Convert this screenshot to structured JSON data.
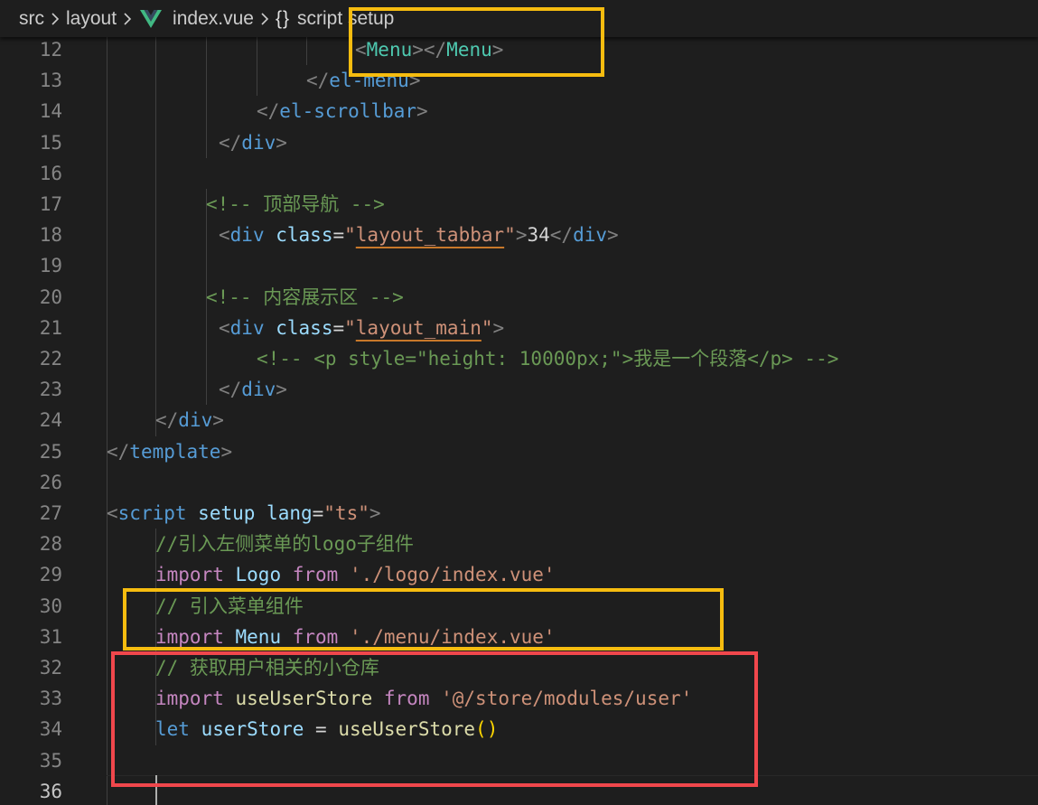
{
  "breadcrumb": {
    "items": [
      "src",
      "layout",
      "index.vue",
      "script setup"
    ],
    "braces_glyph": "{}",
    "vue_icon": "vue-logo-icon",
    "chevron_icon": "chevron-right-icon"
  },
  "colors": {
    "background": "#1e1e1e",
    "line_number": "#858585",
    "highlight_yellow": "#f6bc0f",
    "highlight_red": "#f0474c"
  },
  "editor": {
    "active_line": "36",
    "lines": [
      {
        "number": "12",
        "indent": 0,
        "tokens": [
          [
            "bracket",
            "<"
          ],
          [
            "comp",
            "Menu"
          ],
          [
            "bracket",
            "></"
          ],
          [
            "comp",
            "Menu"
          ],
          [
            "bracket",
            ">"
          ]
        ]
      },
      {
        "number": "13",
        "indent": 0,
        "tokens": [
          [
            "bracket",
            "</"
          ],
          [
            "tag",
            "el-menu"
          ],
          [
            "bracket",
            ">"
          ]
        ]
      },
      {
        "number": "14",
        "indent": 0,
        "tokens": [
          [
            "bracket",
            "</"
          ],
          [
            "tag",
            "el-scrollbar"
          ],
          [
            "bracket",
            ">"
          ]
        ]
      },
      {
        "number": "15",
        "indent": 0,
        "tokens": [
          [
            "bracket",
            "</"
          ],
          [
            "tag",
            "div"
          ],
          [
            "bracket",
            ">"
          ]
        ]
      },
      {
        "number": "16",
        "indent": 0,
        "tokens": []
      },
      {
        "number": "17",
        "indent": 0,
        "tokens": [
          [
            "comment",
            "<!-- 顶部导航 -->"
          ]
        ]
      },
      {
        "number": "18",
        "indent": 0,
        "tokens": [
          [
            "bracket",
            "<"
          ],
          [
            "tag",
            "div"
          ],
          [
            "plain",
            " "
          ],
          [
            "attr",
            "class"
          ],
          [
            "plain",
            "="
          ],
          [
            "str",
            "\""
          ],
          [
            "strcls",
            "layout_tabbar"
          ],
          [
            "str",
            "\""
          ],
          [
            "bracket",
            ">"
          ],
          [
            "plain",
            "34"
          ],
          [
            "bracket",
            "</"
          ],
          [
            "tag",
            "div"
          ],
          [
            "bracket",
            ">"
          ]
        ]
      },
      {
        "number": "19",
        "indent": 0,
        "tokens": []
      },
      {
        "number": "20",
        "indent": 0,
        "tokens": [
          [
            "comment",
            "<!-- 内容展示区 -->"
          ]
        ]
      },
      {
        "number": "21",
        "indent": 0,
        "tokens": [
          [
            "bracket",
            "<"
          ],
          [
            "tag",
            "div"
          ],
          [
            "plain",
            " "
          ],
          [
            "attr",
            "class"
          ],
          [
            "plain",
            "="
          ],
          [
            "str",
            "\""
          ],
          [
            "strcls",
            "layout_main"
          ],
          [
            "str",
            "\""
          ],
          [
            "bracket",
            ">"
          ]
        ]
      },
      {
        "number": "22",
        "indent": 0,
        "tokens": [
          [
            "comment",
            "<!-- <p style=\"height: 10000px;\">我是一个段落</p> -->"
          ]
        ]
      },
      {
        "number": "23",
        "indent": 0,
        "tokens": [
          [
            "bracket",
            "</"
          ],
          [
            "tag",
            "div"
          ],
          [
            "bracket",
            ">"
          ]
        ]
      },
      {
        "number": "24",
        "indent": 0,
        "tokens": [
          [
            "bracket",
            "</"
          ],
          [
            "tag",
            "div"
          ],
          [
            "bracket",
            ">"
          ]
        ]
      },
      {
        "number": "25",
        "indent": 0,
        "tokens": [
          [
            "bracket",
            "</"
          ],
          [
            "tag",
            "template"
          ],
          [
            "bracket",
            ">"
          ]
        ]
      },
      {
        "number": "26",
        "indent": 0,
        "tokens": []
      },
      {
        "number": "27",
        "indent": 0,
        "tokens": [
          [
            "bracket",
            "<"
          ],
          [
            "tag",
            "script"
          ],
          [
            "plain",
            " "
          ],
          [
            "attr",
            "setup"
          ],
          [
            "plain",
            " "
          ],
          [
            "attr",
            "lang"
          ],
          [
            "plain",
            "="
          ],
          [
            "str",
            "\"ts\""
          ],
          [
            "bracket",
            ">"
          ]
        ]
      },
      {
        "number": "28",
        "indent": 0,
        "tokens": [
          [
            "comment",
            "//引入左侧菜单的logo子组件"
          ]
        ]
      },
      {
        "number": "29",
        "indent": 0,
        "tokens": [
          [
            "kw",
            "import"
          ],
          [
            "plain",
            " "
          ],
          [
            "var",
            "Logo"
          ],
          [
            "plain",
            " "
          ],
          [
            "kw",
            "from"
          ],
          [
            "plain",
            " "
          ],
          [
            "str",
            "'./logo/index.vue'"
          ]
        ]
      },
      {
        "number": "30",
        "indent": 0,
        "tokens": [
          [
            "comment",
            "// 引入菜单组件"
          ]
        ]
      },
      {
        "number": "31",
        "indent": 0,
        "tokens": [
          [
            "kw",
            "import"
          ],
          [
            "plain",
            " "
          ],
          [
            "var",
            "Menu"
          ],
          [
            "plain",
            " "
          ],
          [
            "kw",
            "from"
          ],
          [
            "plain",
            " "
          ],
          [
            "str",
            "'./menu/index.vue'"
          ]
        ]
      },
      {
        "number": "32",
        "indent": 0,
        "tokens": [
          [
            "comment",
            "// 获取用户相关的小仓库"
          ]
        ]
      },
      {
        "number": "33",
        "indent": 0,
        "tokens": [
          [
            "kw",
            "import"
          ],
          [
            "plain",
            " "
          ],
          [
            "fn",
            "useUserStore"
          ],
          [
            "plain",
            " "
          ],
          [
            "kw",
            "from"
          ],
          [
            "plain",
            " "
          ],
          [
            "str",
            "'@/store/modules/user'"
          ]
        ]
      },
      {
        "number": "34",
        "indent": 0,
        "tokens": [
          [
            "let",
            "let"
          ],
          [
            "plain",
            " "
          ],
          [
            "var",
            "userStore"
          ],
          [
            "plain",
            " = "
          ],
          [
            "fn",
            "useUserStore"
          ],
          [
            "paren",
            "()"
          ]
        ]
      },
      {
        "number": "35",
        "indent": 0,
        "tokens": []
      },
      {
        "number": "36",
        "indent": 0,
        "tokens": []
      }
    ]
  }
}
